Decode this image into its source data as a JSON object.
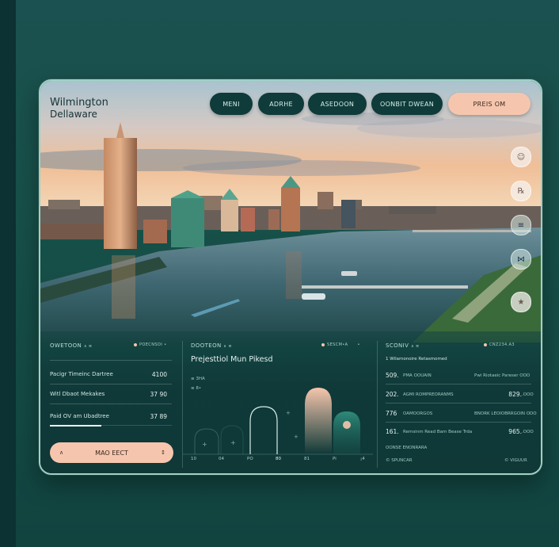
{
  "brand": {
    "city": "Wilmington",
    "state": "Dellaware"
  },
  "nav": {
    "items": [
      "MENI",
      "ADRHE",
      "ASEDOON",
      "OONBIT DWEAN"
    ],
    "primary": "PREIS OM"
  },
  "side_icons": [
    "person-icon",
    "user-icon",
    "list-icon",
    "share-icon",
    "bell-icon"
  ],
  "card1": {
    "title": "OWETOON",
    "title_suffix": "∧ ≡",
    "right_label": "POECNSOI",
    "right_suffix": "•",
    "rows": [
      {
        "label": "Pacigr Timeinc Dartree",
        "value": "4100"
      },
      {
        "label": "Witl Dbaot Mekakes",
        "value": "37 90"
      },
      {
        "label": "Paid OV am Ubadtree",
        "value": "37 89"
      }
    ],
    "progress": 0.42,
    "button_label": "MAO EECT",
    "button_icon_left": "∧",
    "button_icon_right": "↕"
  },
  "card2": {
    "title": "DOOTEON",
    "title_suffix": "∧ ≡",
    "right_label": "SESCM•A",
    "right_suffix": "•",
    "project_title": "Prejesttiol Mun Pikesd",
    "legend": [
      "≡ 3HA",
      "≡ 8•"
    ],
    "x_labels": [
      "10",
      "04",
      "PO",
      "80",
      "81",
      "Pi",
      "¡4"
    ],
    "accent": "#f5c6ad",
    "teal": "#2f8a7a"
  },
  "card3": {
    "title": "SCONIV",
    "title_suffix": "∧ ≡",
    "right_label": "CNZ234.A3",
    "subtitle": "1 Wilamonoire Retasmomed",
    "rows": [
      {
        "num": "509.",
        "desc": "PMA OOUAIN",
        "right_desc": "Pwi Riotaeic Pareser OOO",
        "value": ""
      },
      {
        "num": "202.",
        "desc": "AGMI ROMPREORANMS",
        "right_desc": "",
        "value": "829."
      },
      {
        "num": "776",
        "desc": "OAMOORGOS",
        "right_desc": "BNORK LEOIOBRRGOIN ODO",
        "value": ""
      },
      {
        "num": "161.",
        "desc": "Remsinm Read Bam Bease Trda",
        "right_desc": "",
        "value": "965."
      }
    ],
    "row_value_suffix": ".OOO",
    "footer_left": "OONSE ENONRARA",
    "footer_mid": "© SPUNCAR",
    "footer_right": "© VIGUUR"
  }
}
